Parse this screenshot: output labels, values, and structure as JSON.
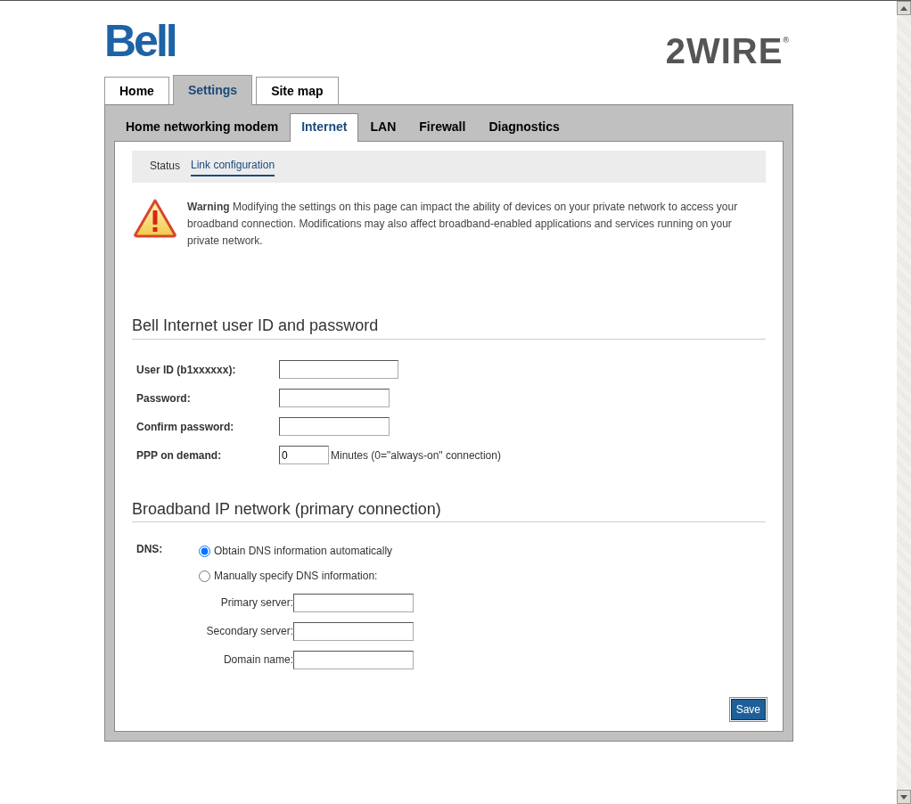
{
  "logos": {
    "brand": "Bell",
    "partner": "2WIRE",
    "partner_mark": "®"
  },
  "tabs": [
    {
      "label": "Home",
      "selected": false
    },
    {
      "label": "Settings",
      "selected": true
    },
    {
      "label": "Site map",
      "selected": false
    }
  ],
  "subtabs": [
    {
      "label": "Home networking modem",
      "selected": false
    },
    {
      "label": "Internet",
      "selected": true
    },
    {
      "label": "LAN",
      "selected": false
    },
    {
      "label": "Firewall",
      "selected": false
    },
    {
      "label": "Diagnostics",
      "selected": false
    }
  ],
  "subnav": [
    {
      "label": "Status",
      "selected": false
    },
    {
      "label": "Link configuration",
      "selected": true
    }
  ],
  "warning": {
    "text": "**Warning** Modifying the settings on this page can impact the ability of devices on your private network to access your broadband connection. Modifications may also affect broadband-enabled applications and services running on your private network."
  },
  "account": {
    "heading": "Bell Internet user ID and password",
    "fields": [
      {
        "label": "User ID (b1xxxxxx):",
        "kind": "text"
      },
      {
        "label": "Password:",
        "kind": "password"
      },
      {
        "label": "Confirm password:",
        "kind": "password"
      },
      {
        "label": "PPP on demand:",
        "kind": "number",
        "value": "0",
        "suffix": "Minutes (0=\"always-on\" connection)"
      }
    ]
  },
  "network": {
    "heading": "Broadband IP network (primary connection)",
    "dns_label": "DNS:",
    "options": [
      {
        "label": "Obtain DNS information automatically",
        "selected": true
      },
      {
        "label": "Manually specify DNS information:",
        "selected": false
      }
    ],
    "fields": [
      {
        "label": "Primary server:"
      },
      {
        "label": "Secondary server:"
      },
      {
        "label": "Domain name:"
      }
    ]
  },
  "save_button": "Save"
}
